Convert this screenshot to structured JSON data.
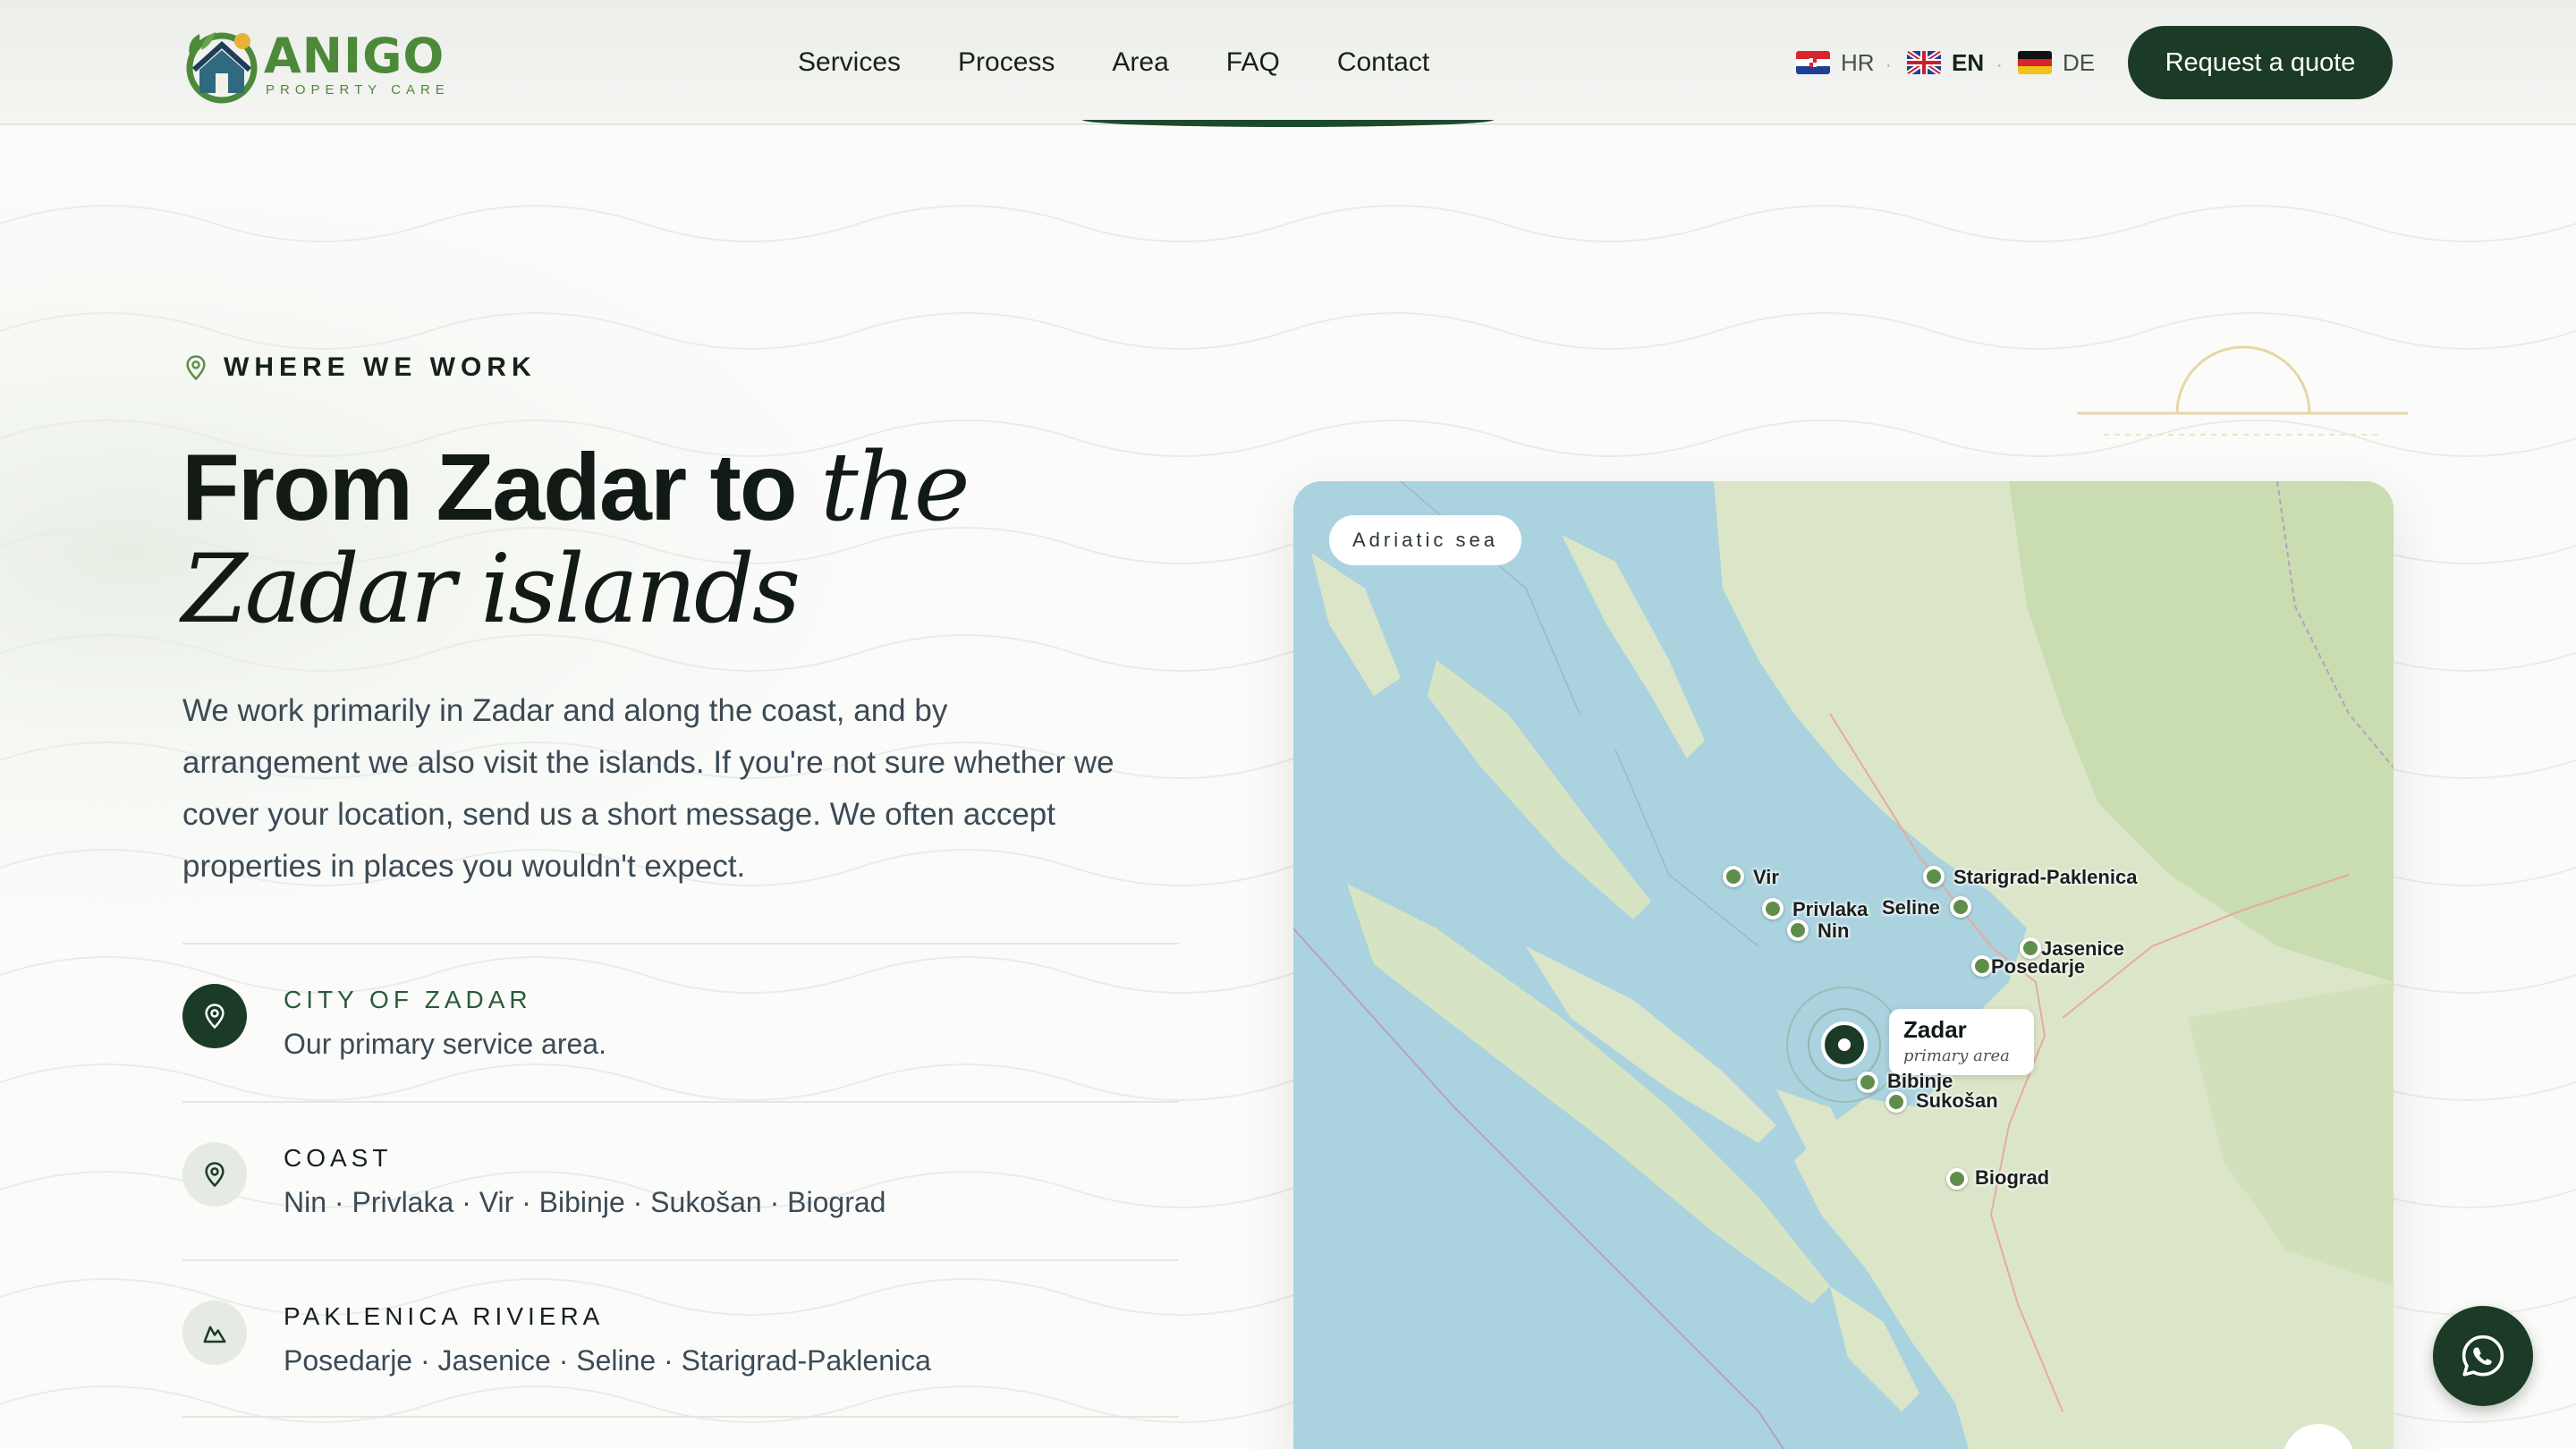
{
  "header": {
    "logo_word": "ANIGO",
    "logo_sub": "PROPERTY CARE",
    "nav": [
      "Services",
      "Process",
      "Area",
      "FAQ",
      "Contact"
    ],
    "languages": [
      {
        "code": "HR",
        "flag_icon": "croatia-flag-icon",
        "active": false
      },
      {
        "code": "EN",
        "flag_icon": "uk-flag-icon",
        "active": true
      },
      {
        "code": "DE",
        "flag_icon": "germany-flag-icon",
        "active": false
      }
    ],
    "cta": "Request a quote"
  },
  "section": {
    "eyebrow": "WHERE WE WORK",
    "title_plain": "From Zadar to ",
    "title_italic_1": "the",
    "title_italic_2": "Zadar islands",
    "intro": "We work primarily in Zadar and along the coast, and by arrangement we also visit the islands. If you're not sure whether we cover your location, send us a short message. We often accept properties in places you wouldn't expect.",
    "areas": [
      {
        "title": "CITY OF ZADAR",
        "desc": "Our primary service area.",
        "icon": "map-pin-icon",
        "style": "dark"
      },
      {
        "title": "COAST",
        "desc": "Nin · Privlaka · Vir · Bibinje · Sukošan · Biograd",
        "icon": "map-pin-icon",
        "style": "light"
      },
      {
        "title": "PAKLENICA RIVIERA",
        "desc": "Posedarje · Jasenice · Seline · Starigrad-Paklenica",
        "icon": "mountain-icon",
        "style": "light"
      }
    ]
  },
  "map": {
    "chip": "Adriatic sea",
    "main_pin": {
      "name": "Zadar",
      "sub": "primary area"
    },
    "pins": [
      "Vir",
      "Privlaka",
      "Nin",
      "Seline",
      "Starigrad-Paklenica",
      "Jasenice",
      "Posedarje",
      "Bibinje",
      "Sukošan",
      "Biograd"
    ]
  },
  "colors": {
    "brand": "#1b3b27",
    "accent": "#5f8d4a",
    "logo": "#4c8a3a"
  }
}
